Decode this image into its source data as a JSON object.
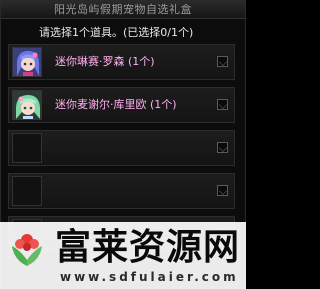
{
  "window": {
    "title": "阳光岛屿假期宠物自选礼盒",
    "instruction": "请选择1个道具。(已选择0/1个)"
  },
  "items": [
    {
      "label": "迷你琳赛·罗森 (1个)",
      "icon": "avatar-blue-hair",
      "selected": false
    },
    {
      "label": "迷你麦谢尔·库里欧 (1个)",
      "icon": "avatar-green-hair",
      "selected": false
    },
    {
      "label": "",
      "icon": "",
      "selected": false
    },
    {
      "label": "",
      "icon": "",
      "selected": false
    },
    {
      "label": "",
      "icon": "",
      "selected": false
    }
  ],
  "watermark": {
    "title": "富莱资源网",
    "url": "www.sdfulaier.com"
  },
  "colors": {
    "item_name": "#ffb0f0",
    "watermark_leaf": "#4caf50",
    "watermark_flower": "#e53935"
  }
}
